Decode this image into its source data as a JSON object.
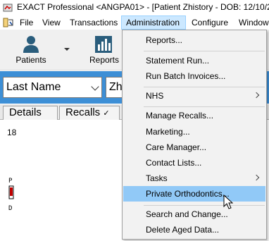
{
  "window": {
    "title": "EXACT Professional <ANGPA01> - [Patient Zhistory - DOB: 12/10/201"
  },
  "menubar": {
    "items": [
      "File",
      "View",
      "Transactions",
      "Administration",
      "Configure",
      "Window"
    ],
    "active": "Administration"
  },
  "toolbar": {
    "patients_label": "Patients",
    "reports_label": "Reports"
  },
  "search": {
    "field_value": "Last Name",
    "input_value": "Zh"
  },
  "tabs": {
    "details_label": "Details",
    "recalls_label": "Recalls"
  },
  "content": {
    "number": "18"
  },
  "admin_menu": {
    "items": [
      {
        "label": "Reports..."
      },
      {
        "label": "Statement Run..."
      },
      {
        "label": "Run Batch Invoices..."
      },
      {
        "label": "NHS",
        "submenu": true
      },
      {
        "label": "Manage Recalls..."
      },
      {
        "label": "Marketing..."
      },
      {
        "label": "Care Manager..."
      },
      {
        "label": "Contact Lists..."
      },
      {
        "label": "Tasks",
        "submenu": true
      },
      {
        "label": "Private Orthodontics...",
        "highlighted": true
      },
      {
        "label": "Search and Change..."
      },
      {
        "label": "Delete Aged Data..."
      }
    ]
  },
  "colors": {
    "accent_band": "#3d8fd6",
    "menu_highlight": "#91c9f7",
    "menubar_active": "#cce8ff"
  }
}
